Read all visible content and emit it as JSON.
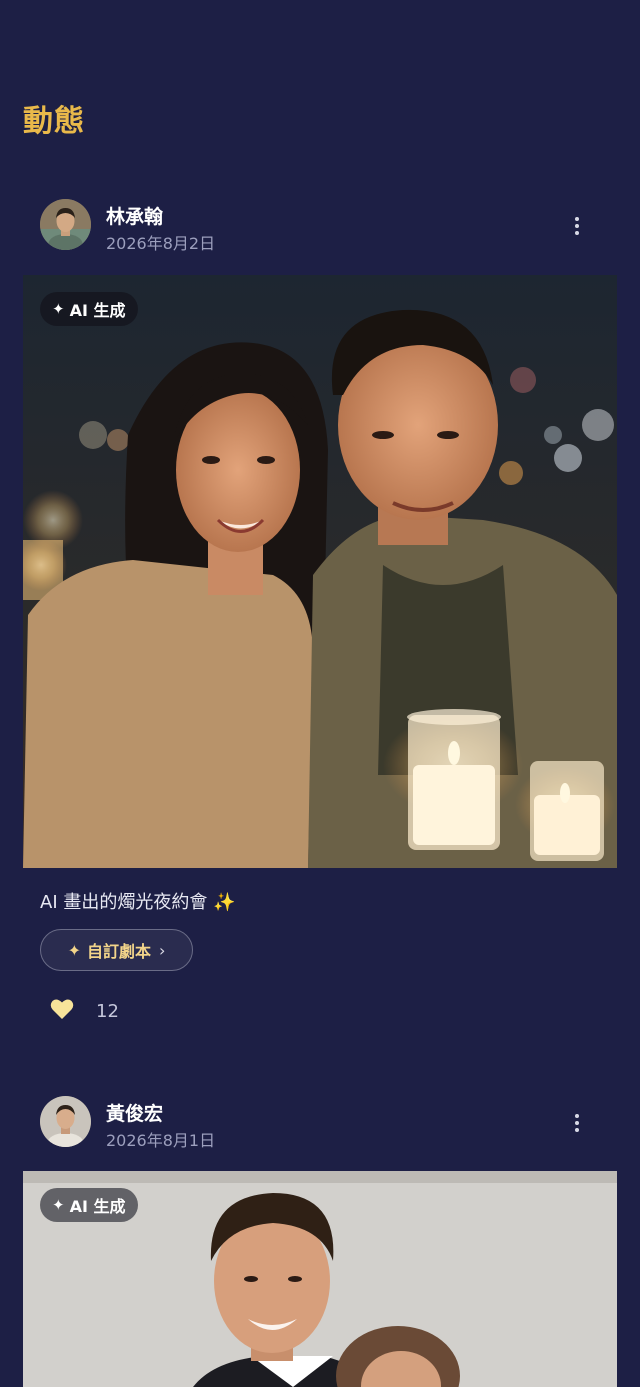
{
  "header": {
    "title": "動態"
  },
  "posts": [
    {
      "author": "林承翰",
      "date": "2026年8月2日",
      "badge": "AI 生成",
      "caption": "AI 畫出的燭光夜約會 ✨",
      "script_button": "自訂劇本",
      "likes": "12"
    },
    {
      "author": "黃俊宏",
      "date": "2026年8月1日",
      "badge": "AI 生成"
    }
  ],
  "colors": {
    "background": "#1d1f45",
    "title": "#e9b94a",
    "accent": "#f3d58a",
    "heart": "#f7e39a"
  },
  "icons": {
    "more": "more-vertical-icon",
    "sparkle": "sparkle-icon",
    "heart": "heart-icon",
    "chevron": "chevron-right-icon"
  }
}
